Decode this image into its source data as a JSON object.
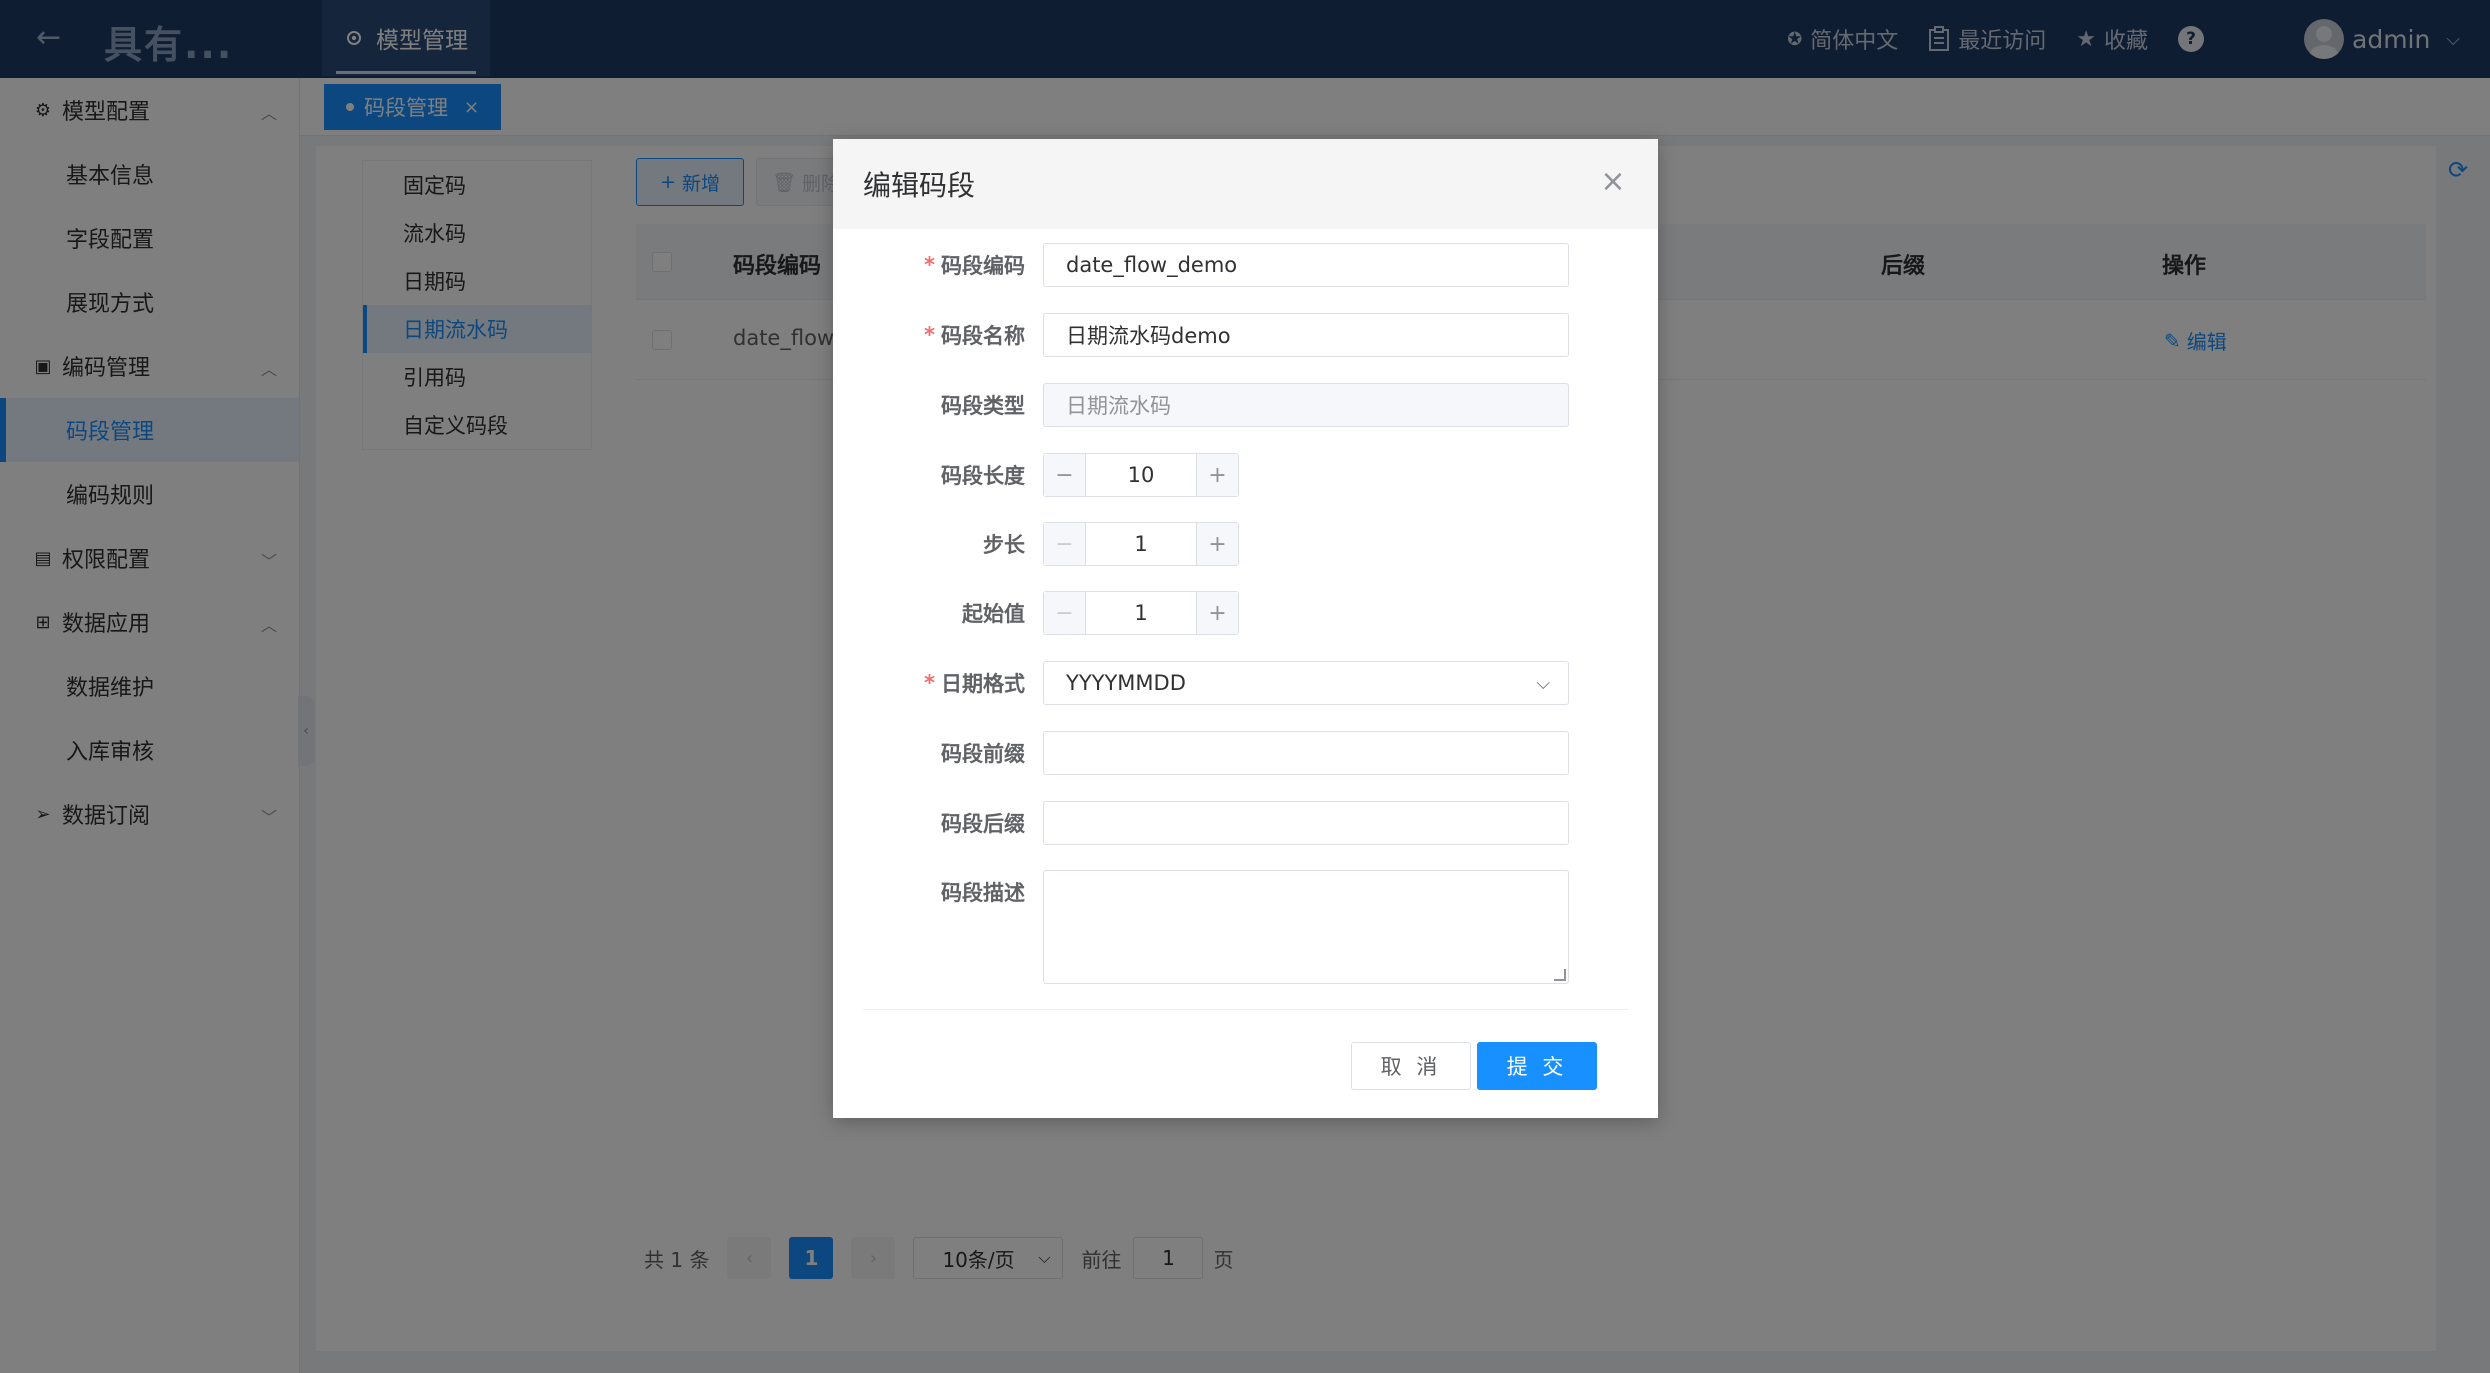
{
  "header": {
    "logo_text": "具有...",
    "nav_tab": "模型管理",
    "language": "简体中文",
    "recent": "最近访问",
    "favorites": "收藏",
    "help": "?",
    "user": "admin"
  },
  "sidebar": {
    "groups": [
      {
        "label": "模型配置",
        "items": [
          "基本信息",
          "字段配置",
          "展现方式"
        ]
      },
      {
        "label": "编码管理",
        "items": [
          "码段管理",
          "编码规则"
        ]
      },
      {
        "label": "权限配置",
        "items": []
      },
      {
        "label": "数据应用",
        "items": [
          "数据维护",
          "入库审核"
        ]
      },
      {
        "label": "数据订阅",
        "items": []
      }
    ]
  },
  "tabs": [
    {
      "label": "码段管理",
      "close": "×"
    }
  ],
  "categories": [
    "固定码",
    "流水码",
    "日期码",
    "日期流水码",
    "引用码",
    "自定义码段"
  ],
  "toolbar": {
    "add": "新增",
    "delete": "删除"
  },
  "table": {
    "headers": {
      "code": "码段编码",
      "suffix": "后缀",
      "actions": "操作"
    },
    "rows": [
      {
        "code": "date_flow_",
        "edit": "编辑"
      }
    ]
  },
  "pager": {
    "total": "共 1 条",
    "page": "1",
    "size": "10条/页",
    "goto": "前往",
    "jump_value": "1",
    "page_unit": "页"
  },
  "dialog": {
    "title": "编辑码段",
    "close": "×",
    "fields": {
      "code": {
        "label": "码段编码",
        "value": "date_flow_demo"
      },
      "name": {
        "label": "码段名称",
        "value": "日期流水码demo"
      },
      "type": {
        "label": "码段类型",
        "value": "日期流水码"
      },
      "length": {
        "label": "码段长度",
        "value": "10"
      },
      "step": {
        "label": "步长",
        "value": "1"
      },
      "start": {
        "label": "起始值",
        "value": "1"
      },
      "date_format": {
        "label": "日期格式",
        "value": "YYYYMMDD"
      },
      "prefix": {
        "label": "码段前缀",
        "value": ""
      },
      "suffix": {
        "label": "码段后缀",
        "value": ""
      },
      "desc": {
        "label": "码段描述",
        "value": ""
      }
    },
    "required_mark": "*",
    "cancel": "取 消",
    "submit": "提 交"
  },
  "colors": {
    "primary": "#1890ff",
    "header_bg": "#1f3a64",
    "required": "#f56c6c"
  }
}
